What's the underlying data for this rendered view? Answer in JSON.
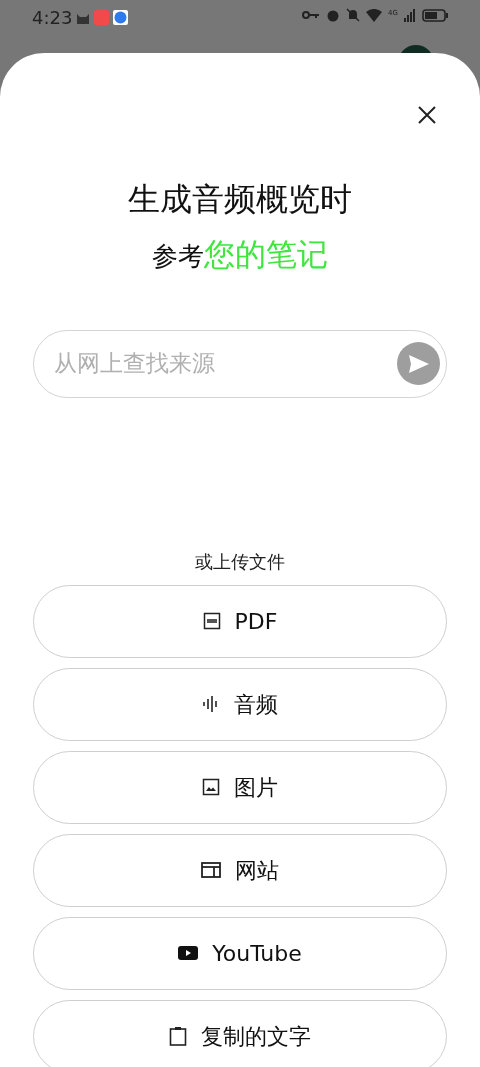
{
  "status_bar": {
    "time": "4:23",
    "network": "4G"
  },
  "title": "生成音频概览时",
  "subtitle": {
    "prefix": "参考",
    "highlight": "您的笔记"
  },
  "search": {
    "placeholder": "从网上查找来源"
  },
  "upload_label": "或上传文件",
  "sources": [
    {
      "kind": "pdf",
      "label": "PDF"
    },
    {
      "kind": "audio",
      "label": "音频"
    },
    {
      "kind": "image",
      "label": "图片"
    },
    {
      "kind": "website",
      "label": "网站"
    },
    {
      "kind": "youtube",
      "label": "YouTube"
    },
    {
      "kind": "clipboard",
      "label": "复制的文字"
    }
  ]
}
